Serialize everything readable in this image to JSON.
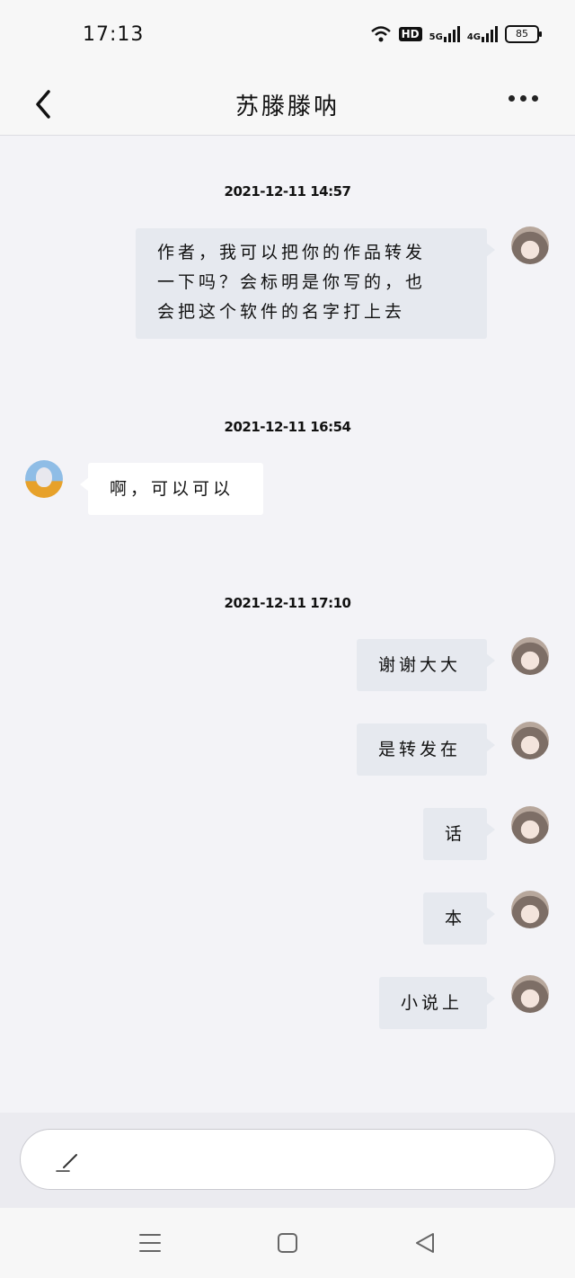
{
  "status_bar": {
    "time": "17:13",
    "hd": "HD",
    "net1": "5G",
    "net2": "4G",
    "battery": "85"
  },
  "header": {
    "title": "苏滕滕呐"
  },
  "timestamps": [
    "2021-12-11 14:57",
    "2021-12-11 16:54",
    "2021-12-11 17:10"
  ],
  "messages": [
    {
      "sender": "me",
      "lines": [
        "作者，我可以把你的作品转发",
        "一下吗？会标明是你写的，也",
        "会把这个软件的名字打上去"
      ]
    },
    {
      "sender": "them",
      "text": "啊，可以可以"
    },
    {
      "sender": "me",
      "text": "谢谢大大"
    },
    {
      "sender": "me",
      "text": "是转发在"
    },
    {
      "sender": "me",
      "text": "话"
    },
    {
      "sender": "me",
      "text": "本"
    },
    {
      "sender": "me",
      "text": "小说上"
    }
  ],
  "input": {
    "placeholder": ""
  },
  "icons": {
    "back": "chevron-left-icon",
    "more": "more-dots-icon",
    "pen": "pen-icon",
    "nav_menu": "menu-icon",
    "nav_home": "home-square-icon",
    "nav_back": "back-triangle-icon"
  }
}
